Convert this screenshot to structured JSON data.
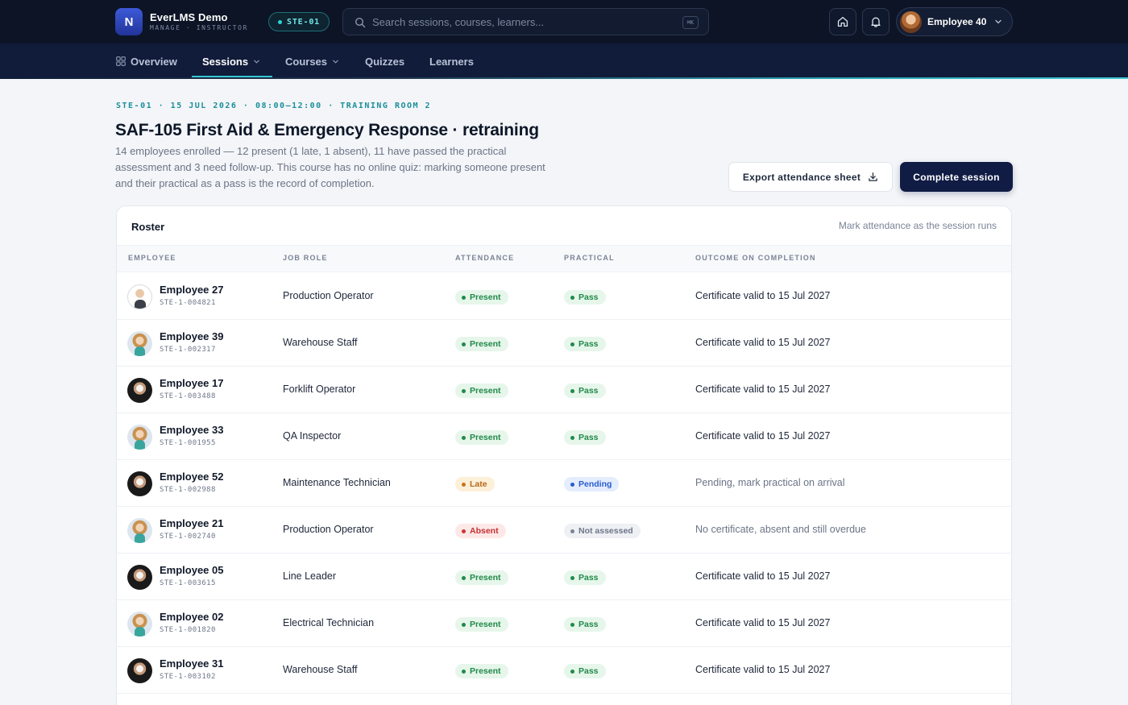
{
  "app": {
    "logo_letter": "N",
    "name": "EverLMS Demo",
    "subtitle": "MANAGE · INSTRUCTOR",
    "session_code": "STE-01"
  },
  "search": {
    "placeholder": "Search sessions, courses, learners...",
    "shortcut": "⌘K"
  },
  "user": {
    "name": "Employee 40"
  },
  "nav": [
    {
      "label": "Overview",
      "active": false
    },
    {
      "label": "Sessions",
      "active": true
    },
    {
      "label": "Courses",
      "active": false
    },
    {
      "label": "Quizzes",
      "active": false
    },
    {
      "label": "Learners",
      "active": false
    }
  ],
  "header": {
    "eyebrow": "STE-01 · 15 JUL 2026 · 08:00–12:00 · TRAINING ROOM 2",
    "title": "SAF-105 First Aid & Emergency Response · retraining",
    "description": "14 employees enrolled — 12 present (1 late, 1 absent), 11 have passed the practical assessment and 3 need follow-up. This course has no online quiz: marking someone present and their practical as a pass is the record of completion.",
    "export_label": "Export attendance sheet",
    "complete_label": "Complete session"
  },
  "roster": {
    "title": "Roster",
    "hint": "Mark attendance as the session runs",
    "columns": [
      "EMPLOYEE",
      "JOB ROLE",
      "ATTENDANCE",
      "PRACTICAL",
      "OUTCOME ON COMPLETION"
    ],
    "rows": [
      {
        "name": "Employee 27",
        "id": "STE-1-004821",
        "role": "Production Operator",
        "attendance": "Present",
        "practical": "Pass",
        "outcome": "Certificate valid to 15 Jul 2027"
      },
      {
        "name": "Employee 39",
        "id": "STE-1-002317",
        "role": "Warehouse Staff",
        "attendance": "Present",
        "practical": "Pass",
        "outcome": "Certificate valid to 15 Jul 2027"
      },
      {
        "name": "Employee 17",
        "id": "STE-1-003488",
        "role": "Forklift Operator",
        "attendance": "Present",
        "practical": "Pass",
        "outcome": "Certificate valid to 15 Jul 2027"
      },
      {
        "name": "Employee 33",
        "id": "STE-1-001955",
        "role": "QA Inspector",
        "attendance": "Present",
        "practical": "Pass",
        "outcome": "Certificate valid to 15 Jul 2027"
      },
      {
        "name": "Employee 52",
        "id": "STE-1-002988",
        "role": "Maintenance Technician",
        "attendance": "Late",
        "practical": "Pending",
        "outcome": "Pending, mark practical on arrival"
      },
      {
        "name": "Employee 21",
        "id": "STE-1-002740",
        "role": "Production Operator",
        "attendance": "Absent",
        "practical": "Not assessed",
        "outcome": "No certificate, absent and still overdue"
      },
      {
        "name": "Employee 05",
        "id": "STE-1-003615",
        "role": "Line Leader",
        "attendance": "Present",
        "practical": "Pass",
        "outcome": "Certificate valid to 15 Jul 2027"
      },
      {
        "name": "Employee 02",
        "id": "STE-1-001820",
        "role": "Electrical Technician",
        "attendance": "Present",
        "practical": "Pass",
        "outcome": "Certificate valid to 15 Jul 2027"
      },
      {
        "name": "Employee 31",
        "id": "STE-1-003102",
        "role": "Warehouse Staff",
        "attendance": "Present",
        "practical": "Pass",
        "outcome": "Certificate valid to 15 Jul 2027"
      }
    ]
  },
  "colors": {
    "topbar": "#0c1426",
    "nav": "#101c3a",
    "accent_teal": "#34c6d1",
    "primary_button": "#111c45",
    "present": "#21894a",
    "late": "#b5681a",
    "pending": "#2a5bd0",
    "absent": "#c43232"
  }
}
